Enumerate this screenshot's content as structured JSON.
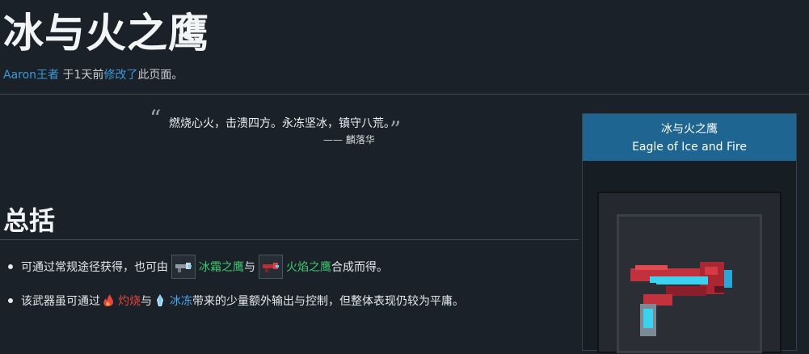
{
  "page": {
    "title": "冰与火之鹰",
    "byline": {
      "author": "Aaron王者",
      "middle": "于1天前",
      "action_link": "修改了",
      "suffix": "此页面。"
    }
  },
  "quote": {
    "open_mark": "“",
    "close_mark": "”",
    "text": "燃烧心火，击溃四方。永冻坚冰，镇守八荒。",
    "author": "—— 麟落华"
  },
  "section": {
    "heading": "总括",
    "bullet1": {
      "before": "可通过常规途径获得，也可由",
      "link1": "冰霜之鹰",
      "mid": "与",
      "link2": "火焰之鹰",
      "after": "合成而得。"
    },
    "bullet2": {
      "before": "该武器虽可通过",
      "effect1": "灼烧",
      "mid": "与",
      "effect2": "冰冻",
      "after": "带来的少量额外输出与控制，但整体表现仍较为平庸。"
    }
  },
  "infobox": {
    "title": "冰与火之鹰",
    "subtitle": "Eagle of Ice and Fire"
  },
  "icons": {
    "ice_eagle": "ice-eagle-icon",
    "fire_eagle": "fire-eagle-icon",
    "burn": "fire-status-icon",
    "freeze": "ice-status-icon",
    "weapon": "eagle-of-ice-and-fire-sprite"
  },
  "colors": {
    "background": "#1b2128",
    "link": "#3a9ad9",
    "green_link": "#3fc96f",
    "burn": "#e5473d",
    "freeze": "#4aa7ef",
    "infobox_header": "#1e6591"
  }
}
